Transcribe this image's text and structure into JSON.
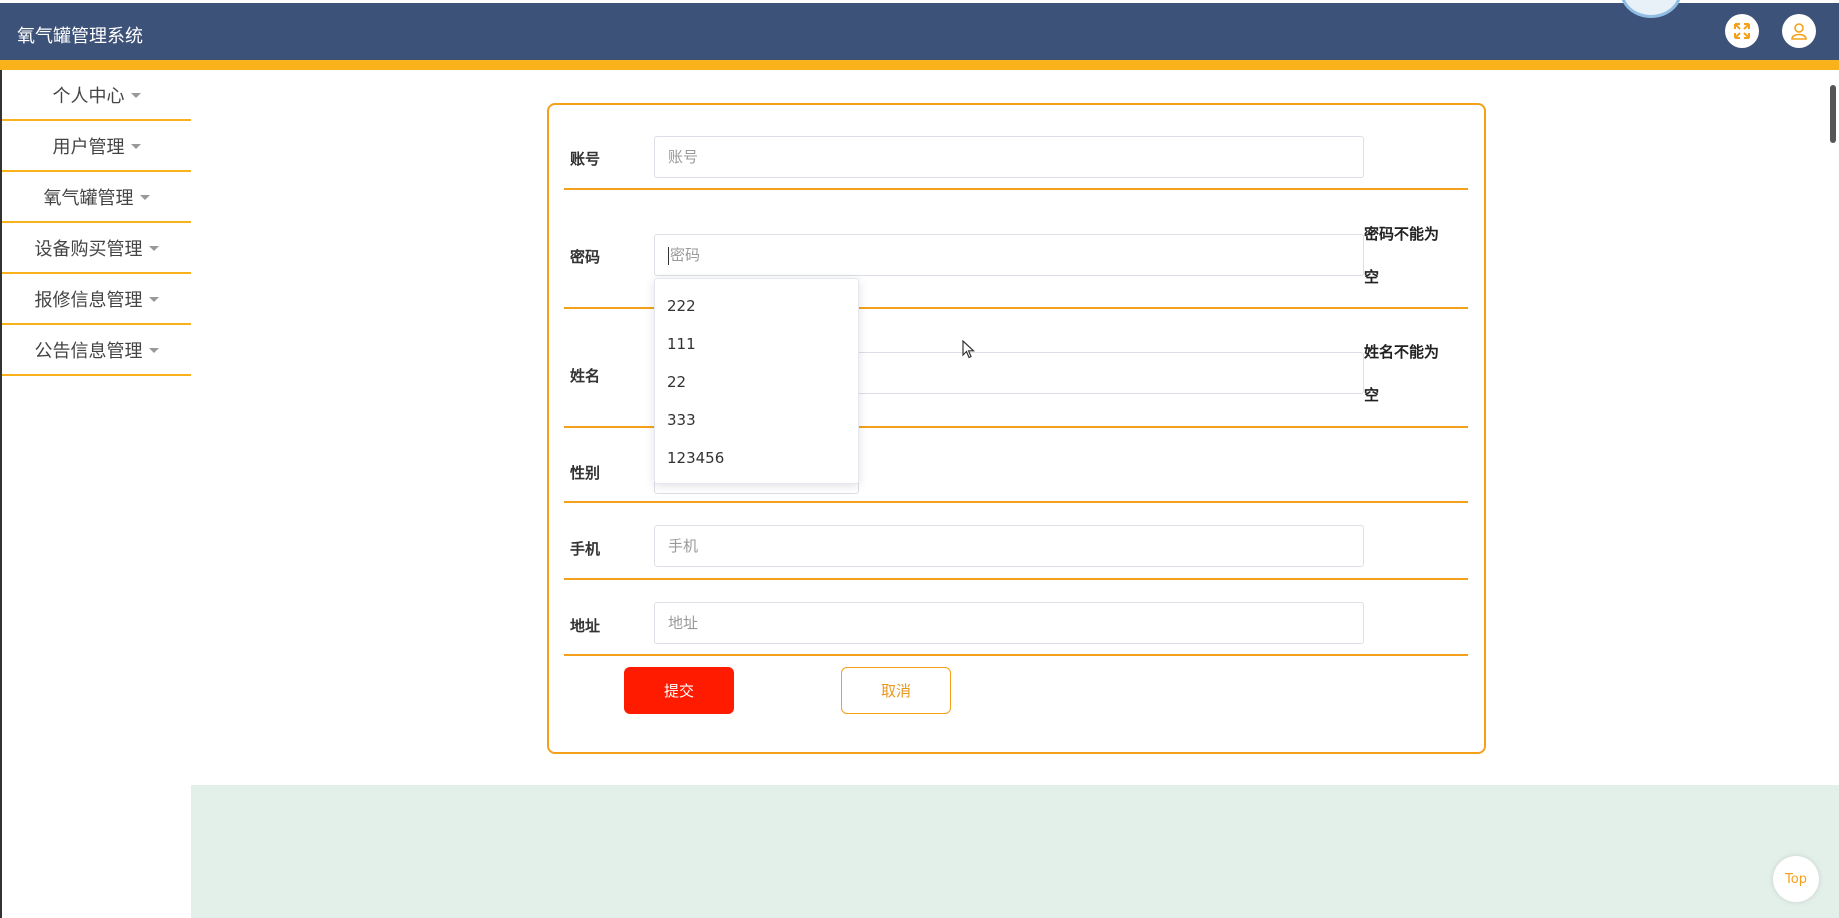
{
  "header": {
    "title": "氧气罐管理系统",
    "icons": [
      "fullscreen-icon",
      "user-icon"
    ],
    "bg_color": "#3d5279",
    "accent_color": "#f9b21c"
  },
  "sidebar": {
    "items": [
      {
        "label": "个人中心"
      },
      {
        "label": "用户管理"
      },
      {
        "label": "氧气罐管理"
      },
      {
        "label": "设备购买管理"
      },
      {
        "label": "报修信息管理"
      },
      {
        "label": "公告信息管理"
      }
    ]
  },
  "form": {
    "account": {
      "label": "账号",
      "placeholder": "账号",
      "value": ""
    },
    "password": {
      "label": "密码",
      "placeholder": "密码",
      "value": "",
      "error_line1": "密码不能为",
      "error_line2": "空"
    },
    "name": {
      "label": "姓名",
      "placeholder": "",
      "value": "",
      "error_line1": "姓名不能为",
      "error_line2": "空"
    },
    "gender": {
      "label": "性别"
    },
    "phone": {
      "label": "手机",
      "placeholder": "手机",
      "value": ""
    },
    "address": {
      "label": "地址",
      "placeholder": "地址",
      "value": ""
    },
    "submit_label": "提交",
    "cancel_label": "取消"
  },
  "autocomplete": {
    "options": [
      "222",
      "111",
      "22",
      "333",
      "123456"
    ]
  },
  "back_to_top": "Top"
}
